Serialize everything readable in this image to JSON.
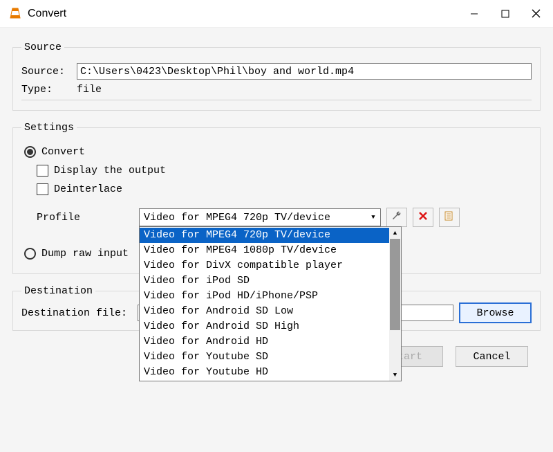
{
  "window": {
    "title": "Convert"
  },
  "source": {
    "legend": "Source",
    "label": "Source:",
    "value": "C:\\Users\\0423\\Desktop\\Phil\\boy and world.mp4",
    "type_label": "Type:",
    "type_value": "file"
  },
  "settings": {
    "legend": "Settings",
    "convert_label": "Convert",
    "display_output_label": "Display the output",
    "deinterlace_label": "Deinterlace",
    "profile_label": "Profile",
    "profile_selected": "Video for MPEG4 720p TV/device",
    "profile_options": [
      "Video for MPEG4 720p TV/device",
      "Video for MPEG4 1080p TV/device",
      "Video for DivX compatible player",
      "Video for iPod SD",
      "Video for iPod HD/iPhone/PSP",
      "Video for Android SD Low",
      "Video for Android SD High",
      "Video for Android HD",
      "Video for Youtube SD",
      "Video for Youtube HD"
    ],
    "dump_raw_label": "Dump raw input"
  },
  "destination": {
    "legend": "Destination",
    "label": "Destination file:",
    "value": "",
    "browse": "Browse"
  },
  "footer": {
    "start": "Start",
    "cancel": "Cancel"
  }
}
